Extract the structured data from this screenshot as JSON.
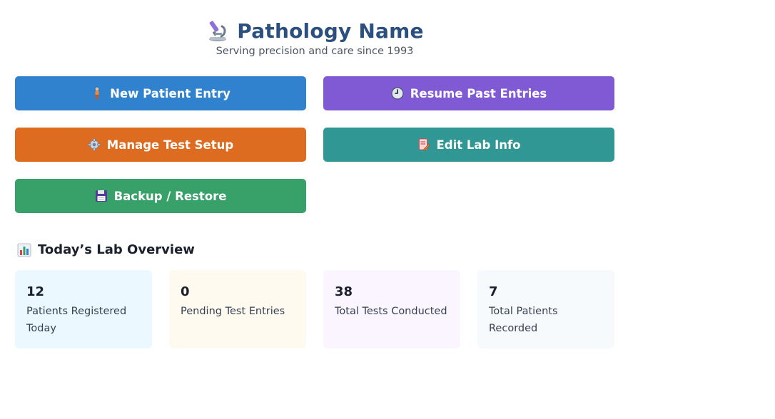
{
  "header": {
    "title": "Pathology Name",
    "subtitle": "Serving precision and care since 1993",
    "icon": "microscope-icon"
  },
  "actions": {
    "new_patient": {
      "label": "New Patient Entry",
      "icon": "person-icon",
      "color": "#3182ce"
    },
    "resume": {
      "label": "Resume Past Entries",
      "icon": "clock-icon",
      "color": "#805ad5"
    },
    "manage_tests": {
      "label": "Manage Test Setup",
      "icon": "gear-icon",
      "color": "#dd6b20"
    },
    "edit_lab": {
      "label": "Edit Lab Info",
      "icon": "document-pencil-icon",
      "color": "#319795"
    },
    "backup": {
      "label": "Backup / Restore",
      "icon": "floppy-disk-icon",
      "color": "#38a169"
    }
  },
  "overview": {
    "heading": "Today’s Lab Overview",
    "icon": "bar-chart-icon",
    "stats": [
      {
        "value": "12",
        "label": "Patients Registered Today",
        "color": "#ebf8ff"
      },
      {
        "value": "0",
        "label": "Pending Test Entries",
        "color": "#fffaf0"
      },
      {
        "value": "38",
        "label": "Total Tests Conducted",
        "color": "#faf5ff"
      },
      {
        "value": "7",
        "label": "Total Patients Recorded",
        "color": "#f7fafc"
      }
    ]
  }
}
